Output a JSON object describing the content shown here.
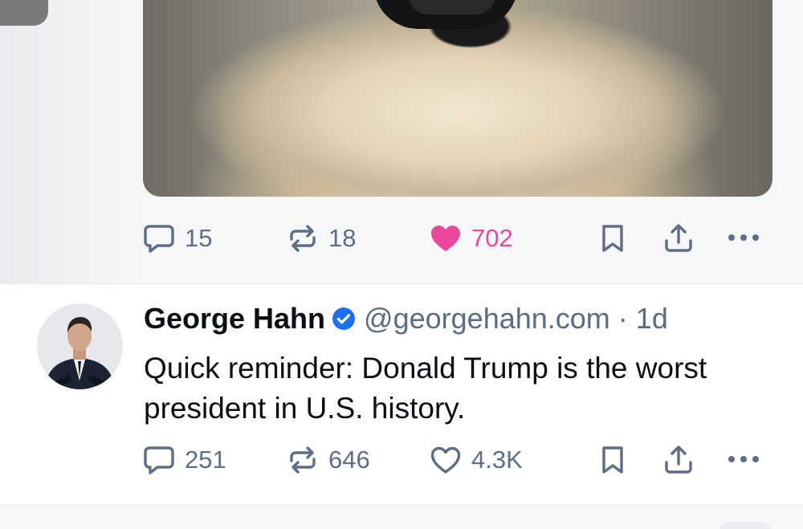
{
  "previous_post": {
    "actions": {
      "replies": "15",
      "reposts": "18",
      "likes": "702",
      "liked": true
    }
  },
  "post": {
    "author_name": "George Hahn",
    "verified": true,
    "handle": "@georgehahn.com",
    "separator": "·",
    "time": "1d",
    "text": "Quick reminder: Donald Trump is the worst president in U.S. history.",
    "actions": {
      "replies": "251",
      "reposts": "646",
      "likes": "4.3K",
      "liked": false
    }
  },
  "colors": {
    "icon_gray": "#5d6e85",
    "like_pink": "#ec4899",
    "verified_blue": "#1d6ff2"
  }
}
